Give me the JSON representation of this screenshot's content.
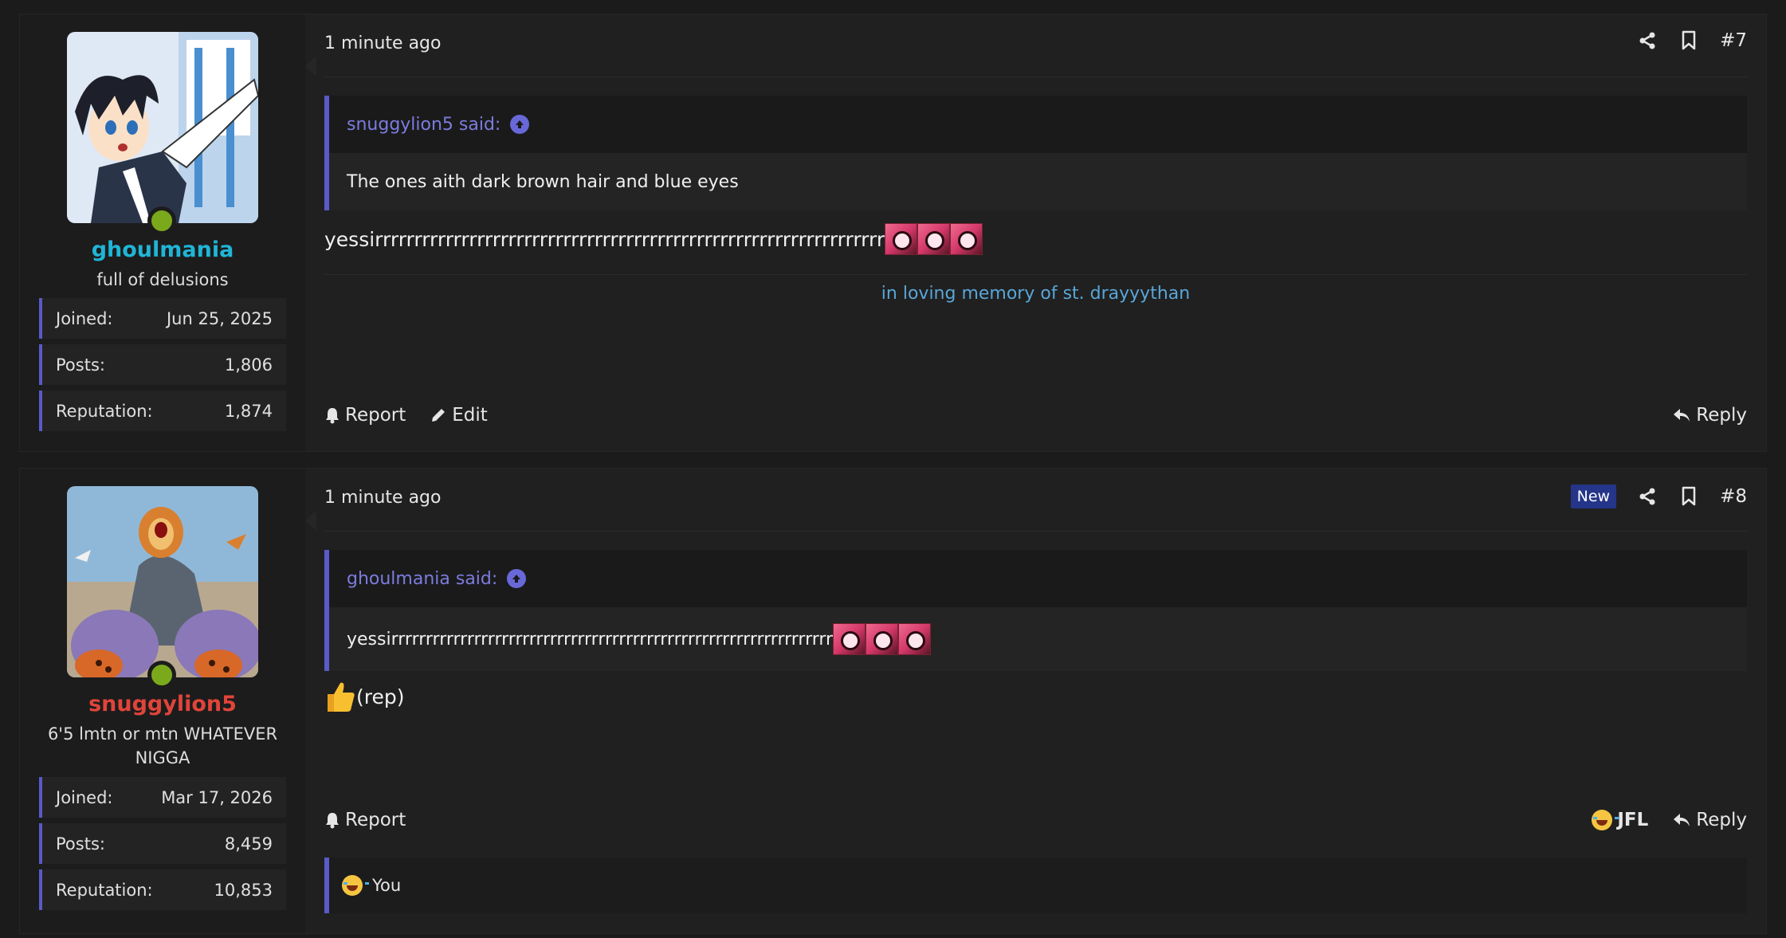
{
  "posts": [
    {
      "user": {
        "username": "ghoulmania",
        "username_color": "#1fb5d6",
        "title": "full of delusions",
        "stats": [
          {
            "label": "Joined:",
            "value": "Jun 25, 2025"
          },
          {
            "label": "Posts:",
            "value": "1,806"
          },
          {
            "label": "Reputation:",
            "value": "1,874"
          }
        ]
      },
      "time": "1 minute ago",
      "post_number": "#7",
      "quote": {
        "author": "snuggylion5 said:",
        "text": "The ones aith dark brown hair and blue eyes"
      },
      "body": "yessirrrrrrrrrrrrrrrrrrrrrrrrrrrrrrrrrrrrrrrrrrrrrrrrrrrrrrrrrrrrrrrrr",
      "signature": "in loving memory of st. drayyythan",
      "actions": {
        "report": "Report",
        "edit": "Edit",
        "reply": "Reply"
      }
    },
    {
      "user": {
        "username": "snuggylion5",
        "username_color": "#e0443a",
        "title": "6'5 lmtn or mtn WHATEVER NIGGA",
        "stats": [
          {
            "label": "Joined:",
            "value": "Mar 17, 2026"
          },
          {
            "label": "Posts:",
            "value": "8,459"
          },
          {
            "label": "Reputation:",
            "value": "10,853"
          }
        ]
      },
      "time": "1 minute ago",
      "badge": "New",
      "post_number": "#8",
      "quote": {
        "author": "ghoulmania said:",
        "text": "yessirrrrrrrrrrrrrrrrrrrrrrrrrrrrrrrrrrrrrrrrrrrrrrrrrrrrrrrrrrrrrrrr"
      },
      "body": "(rep)",
      "actions": {
        "report": "Report",
        "jfl": "JFL",
        "reply": "Reply"
      },
      "reactions": {
        "text": "You"
      }
    }
  ]
}
